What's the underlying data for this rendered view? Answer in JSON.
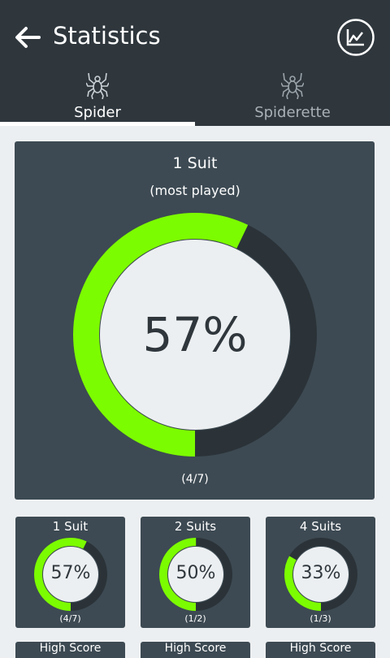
{
  "header": {
    "title": "Statistics"
  },
  "tabs": [
    {
      "label": "Spider",
      "icon": "spider-icon",
      "selected": true
    },
    {
      "label": "Spiderette",
      "icon": "spider-icon",
      "selected": false
    }
  ],
  "main": {
    "title": "1 Suit",
    "subtitle": "(most played)",
    "percent_label": "57%",
    "percent": 0.5714,
    "count": "(4/7)"
  },
  "cards": [
    {
      "title": "1 Suit",
      "percent_label": "57%",
      "percent": 0.5714,
      "count": "(4/7)"
    },
    {
      "title": "2 Suits",
      "percent_label": "50%",
      "percent": 0.5,
      "count": "(1/2)"
    },
    {
      "title": "4 Suits",
      "percent_label": "33%",
      "percent": 0.3333,
      "count": "(1/3)"
    }
  ],
  "high_score_cards": [
    {
      "label": "High Score"
    },
    {
      "label": "High Score"
    },
    {
      "label": "High Score"
    }
  ],
  "colors": {
    "header": "#2f373d",
    "card": "#3d4a53",
    "accent": "#7cfc00",
    "track": "#2b3338",
    "inner": "#eceff1"
  }
}
